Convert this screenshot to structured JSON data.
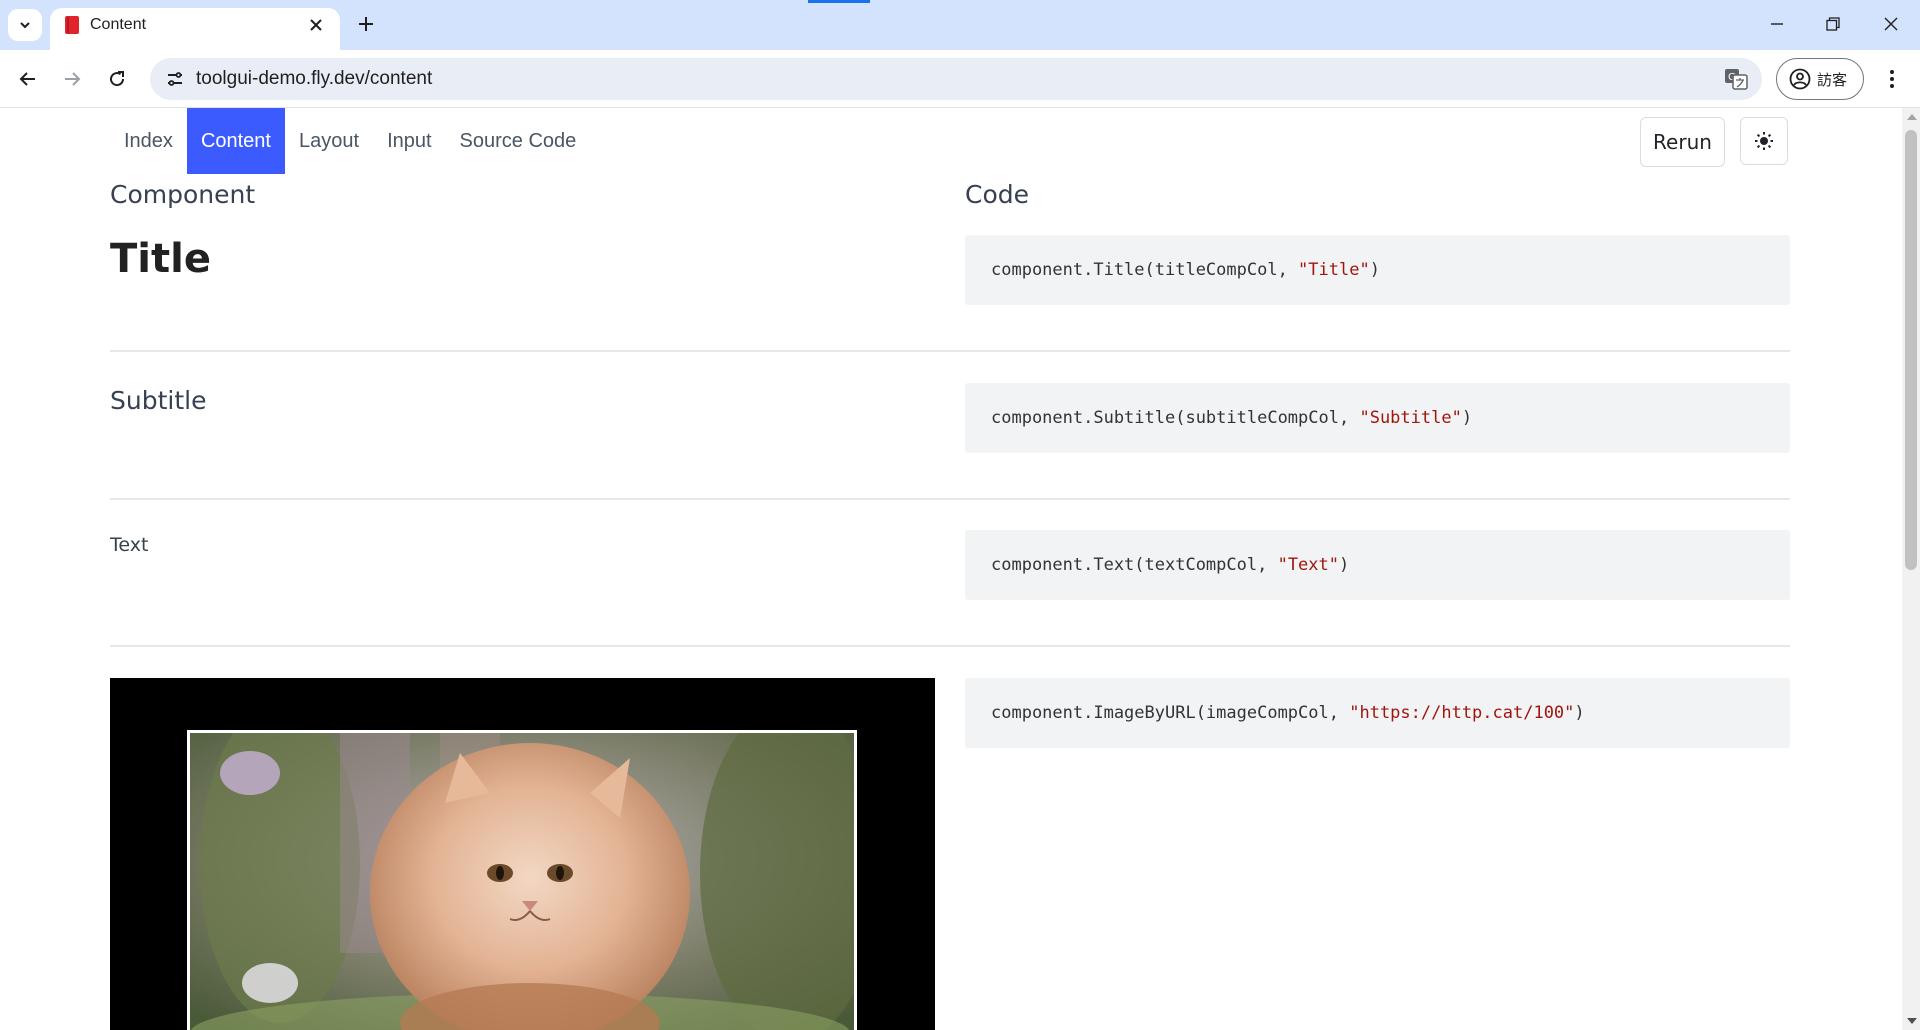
{
  "browser": {
    "tab_title": "Content",
    "url": "toolgui-demo.fly.dev/content",
    "profile_label": "訪客",
    "colors": {
      "chrome_bg": "#d3e3fd",
      "favicon": "#e1242b"
    }
  },
  "page": {
    "nav": {
      "items": [
        "Index",
        "Content",
        "Layout",
        "Input",
        "Source Code"
      ],
      "active": "Content",
      "active_color": "#3b5bff"
    },
    "rerun_label": "Rerun",
    "columns": {
      "component": "Component",
      "code": "Code"
    },
    "rows": {
      "title": {
        "component": "Title",
        "code_prefix": "component.Title(titleCompCol, ",
        "code_string": "\"Title\"",
        "code_suffix": ")"
      },
      "subtitle": {
        "component": "Subtitle",
        "code_prefix": "component.Subtitle(subtitleCompCol, ",
        "code_string": "\"Subtitle\"",
        "code_suffix": ")"
      },
      "text": {
        "component": "Text",
        "code_prefix": "component.Text(textCompCol, ",
        "code_string": "\"Text\"",
        "code_suffix": ")"
      },
      "image": {
        "code_prefix": "component.ImageByURL(imageCompCol, ",
        "code_string": "\"https://http.cat/100\"",
        "code_suffix": ")"
      }
    }
  }
}
